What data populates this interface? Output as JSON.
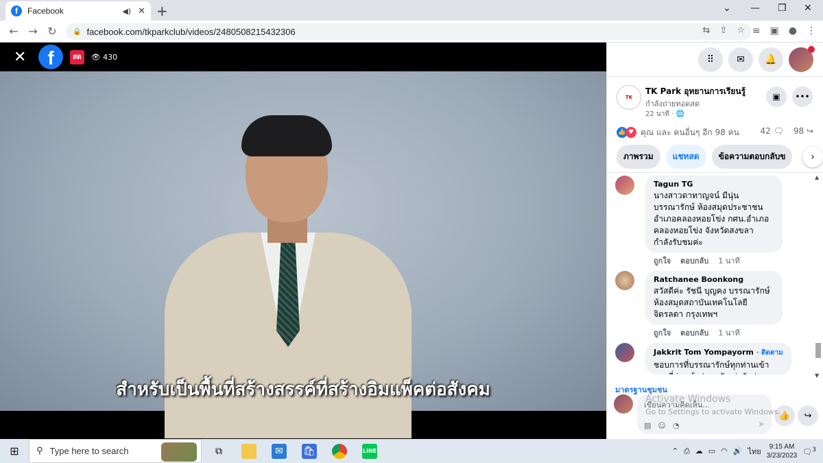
{
  "browser": {
    "tab_title": "Facebook",
    "url": "facebook.com/tkparkclub/videos/2480508215432306"
  },
  "video": {
    "live_label": "สด",
    "viewers": "430",
    "subtitle": "สำหรับเป็นพื้นที่สร้างสรรค์ที่สร้างอิมแพ็คต่อสังคม"
  },
  "post": {
    "page_name": "TK Park อุทยานการเรียนรู้",
    "status": "กำลังถ่ายทอดสด",
    "time": "22 นาที ·",
    "reactions_text": "คุณ และ คนอื่นๆ อีก 98 คน",
    "comments_count": "42",
    "shares_count": "98"
  },
  "tabs": [
    "ภาพรวม",
    "แชทสด",
    "ข้อความตอบกลับข"
  ],
  "comments": [
    {
      "name": "Tagun TG",
      "text": "นางสาวดาทาญจน์ มีนุ่น บรรณารักษ์ ห้องสมุดประชาชน อำเภอคลองหอยโข่ง กศน.อำเภอ คลองหอยโข่ง จังหวัดสงขลา กำลังรับชมค่ะ",
      "like": "ถูกใจ",
      "reply": "ตอบกลับ",
      "time": "1 นาที",
      "follow": ""
    },
    {
      "name": "Ratchanee Boonkong",
      "text": "สวัสดีค่ะ รัชนี บุญคง บรรณารักษ์ ห้องสมุดสถาบันเทคโนโลยี จิตรลดา กรุงเทพฯ",
      "like": "ถูกใจ",
      "reply": "ตอบกลับ",
      "time": "1 นาที",
      "follow": ""
    },
    {
      "name": "Jakkrit Tom Yompayorm",
      "text": "ชอบการที่บรรณารักษ์ทุกท่านเข้ามองที่ว่างเข้าร่วมครับ น่ารักจ่าวว",
      "like": "",
      "reply": "",
      "time": "",
      "follow": "· ติดตาม"
    }
  ],
  "composer": {
    "community_label": "มาตรฐานชุมชน",
    "placeholder": "เขียนความคิดเห็น..."
  },
  "watermark": {
    "line1": "Activate Windows",
    "line2": "Go to Settings to activate Windows."
  },
  "taskbar": {
    "search_placeholder": "Type here to search",
    "lang": "ไทย",
    "time": "9:15 AM",
    "date": "3/23/2023",
    "notif_count": "3"
  },
  "colors": {
    "fb_blue": "#1877f2",
    "live_red": "#e41e3f"
  }
}
